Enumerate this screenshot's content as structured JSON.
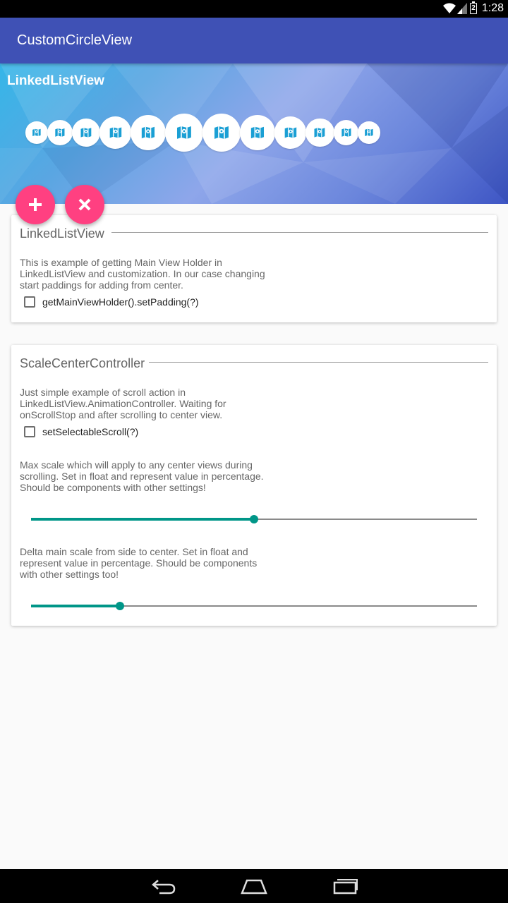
{
  "status_bar": {
    "time": "1:28",
    "battery": "2"
  },
  "app_bar": {
    "title": "CustomCircleView"
  },
  "header": {
    "title": "LinkedListView",
    "items": [
      {
        "icon": "map-icon",
        "scale": 0.68
      },
      {
        "icon": "map-icon",
        "scale": 0.78
      },
      {
        "icon": "map-icon",
        "scale": 0.88
      },
      {
        "icon": "map-icon",
        "scale": 0.98
      },
      {
        "icon": "map-icon",
        "scale": 1.08
      },
      {
        "icon": "map-icon",
        "scale": 1.18
      },
      {
        "icon": "map-icon",
        "scale": 1.18
      },
      {
        "icon": "map-icon",
        "scale": 1.08
      },
      {
        "icon": "map-icon",
        "scale": 0.98
      },
      {
        "icon": "map-icon",
        "scale": 0.88
      },
      {
        "icon": "map-icon",
        "scale": 0.78
      },
      {
        "icon": "map-icon",
        "scale": 0.68
      }
    ]
  },
  "fabs": {
    "add_icon": "plus-icon",
    "remove_icon": "close-icon"
  },
  "card1": {
    "title": "LinkedListView",
    "description_lines": [
      "This is example of getting Main View Holder in",
      "LinkedListView and customization. In our case changing",
      "start paddings for adding from center."
    ],
    "checkbox_label": "getMainViewHolder().setPadding(?)",
    "checkbox_checked": false
  },
  "card2": {
    "title": "ScaleCenterController",
    "description_lines": [
      "Just simple example of scroll action in",
      "LinkedListView.AnimationController. Waiting for",
      "onScrollStop and after scrolling to center view."
    ],
    "checkbox_label": "setSelectableScroll(?)",
    "checkbox_checked": false,
    "max_scale_lines": [
      "Max scale which will apply to any center views during",
      "scrolling. Set in float and represent value in percentage.",
      "Should be components with other settings!"
    ],
    "max_scale_progress": 0.5,
    "delta_scale_lines": [
      "Delta main scale from side to center. Set in float and",
      "represent value in percentage. Should be components",
      "with other settings too!"
    ],
    "delta_scale_progress": 0.2
  },
  "colors": {
    "primary": "#3f51b5",
    "accent": "#ff4081",
    "seek": "#009688",
    "icon": "#1a9fd4"
  }
}
